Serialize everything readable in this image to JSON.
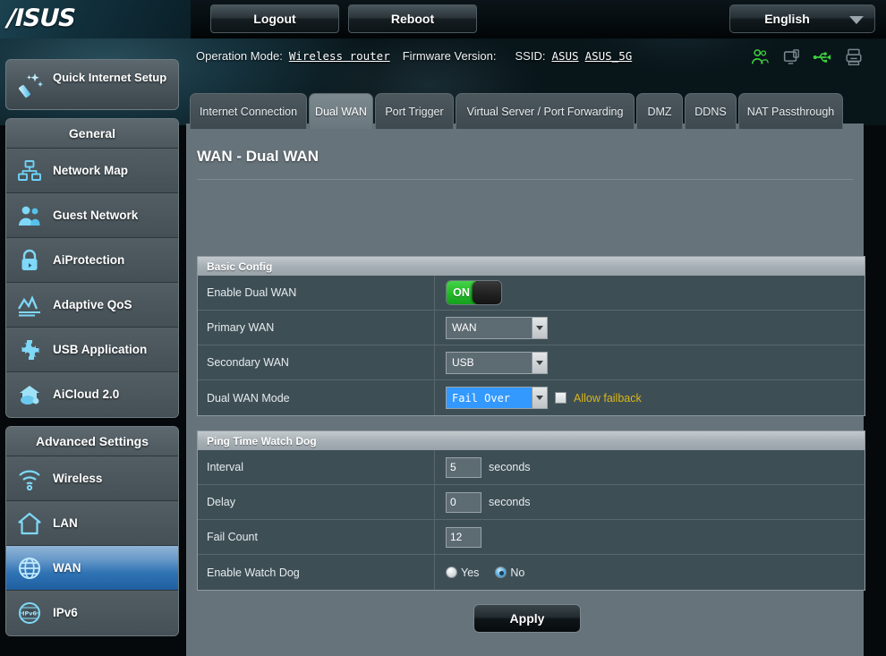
{
  "brand": {
    "logo_text": "/ISUS"
  },
  "topbar": {
    "logout_label": "Logout",
    "reboot_label": "Reboot",
    "language_label": "English"
  },
  "statusbar": {
    "operation_mode_label": "Operation Mode:",
    "operation_mode_value": "Wireless router",
    "firmware_label": "Firmware Version:",
    "firmware_value": "",
    "ssid_label": "SSID:",
    "ssid_value_1": "ASUS",
    "ssid_value_2": "ASUS_5G",
    "icons": [
      {
        "name": "clients-icon",
        "state": "active"
      },
      {
        "name": "monitor-icon",
        "state": "inactive"
      },
      {
        "name": "usb-icon",
        "state": "active"
      },
      {
        "name": "printer-icon",
        "state": "inactive"
      }
    ]
  },
  "sidebar": {
    "quick_setup": {
      "label": "Quick Internet Setup",
      "icon": "magic-wand-icon"
    },
    "groups": [
      {
        "title": "General",
        "items": [
          {
            "label": "Network Map",
            "icon": "network-map-icon",
            "active": false
          },
          {
            "label": "Guest Network",
            "icon": "guest-network-icon",
            "active": false
          },
          {
            "label": "AiProtection",
            "icon": "lock-icon",
            "active": false
          },
          {
            "label": "Adaptive QoS",
            "icon": "chart-icon",
            "active": false
          },
          {
            "label": "USB Application",
            "icon": "puzzle-icon",
            "active": false
          },
          {
            "label": "AiCloud 2.0",
            "icon": "cloud-icon",
            "active": false
          }
        ]
      },
      {
        "title": "Advanced Settings",
        "items": [
          {
            "label": "Wireless",
            "icon": "wifi-icon",
            "active": false
          },
          {
            "label": "LAN",
            "icon": "home-icon",
            "active": false
          },
          {
            "label": "WAN",
            "icon": "globe-icon",
            "active": true
          },
          {
            "label": "IPv6",
            "icon": "ipv6-globe-icon",
            "active": false
          }
        ]
      }
    ]
  },
  "tabs": [
    {
      "label": "Internet Connection",
      "active": false
    },
    {
      "label": "Dual WAN",
      "active": true
    },
    {
      "label": "Port Trigger",
      "active": false
    },
    {
      "label": "Virtual Server / Port Forwarding",
      "active": false
    },
    {
      "label": "DMZ",
      "active": false
    },
    {
      "label": "DDNS",
      "active": false
    },
    {
      "label": "NAT Passthrough",
      "active": false
    }
  ],
  "page": {
    "title": "WAN - Dual WAN"
  },
  "basic_config": {
    "section_title": "Basic Config",
    "enable_dual_wan": {
      "label": "Enable Dual WAN",
      "state": "ON"
    },
    "primary_wan": {
      "label": "Primary WAN",
      "value": "WAN"
    },
    "secondary_wan": {
      "label": "Secondary WAN",
      "value": "USB"
    },
    "dual_wan_mode": {
      "label": "Dual WAN Mode",
      "value": "Fail Over",
      "failback_label": "Allow failback",
      "failback_checked": false
    }
  },
  "watchdog": {
    "section_title": "Ping Time Watch Dog",
    "interval": {
      "label": "Interval",
      "value": "5",
      "unit": "seconds"
    },
    "delay": {
      "label": "Delay",
      "value": "0",
      "unit": "seconds"
    },
    "fail_count": {
      "label": "Fail Count",
      "value": "12"
    },
    "enable": {
      "label": "Enable Watch Dog",
      "yes_label": "Yes",
      "no_label": "No",
      "selected": "No"
    }
  },
  "actions": {
    "apply_label": "Apply"
  },
  "colors": {
    "accent_blue": "#3399ff",
    "switch_green": "#22b828",
    "warning_yellow": "#d8b61c",
    "panel_bg": "#66737a",
    "row_bg": "#3e4e55"
  }
}
